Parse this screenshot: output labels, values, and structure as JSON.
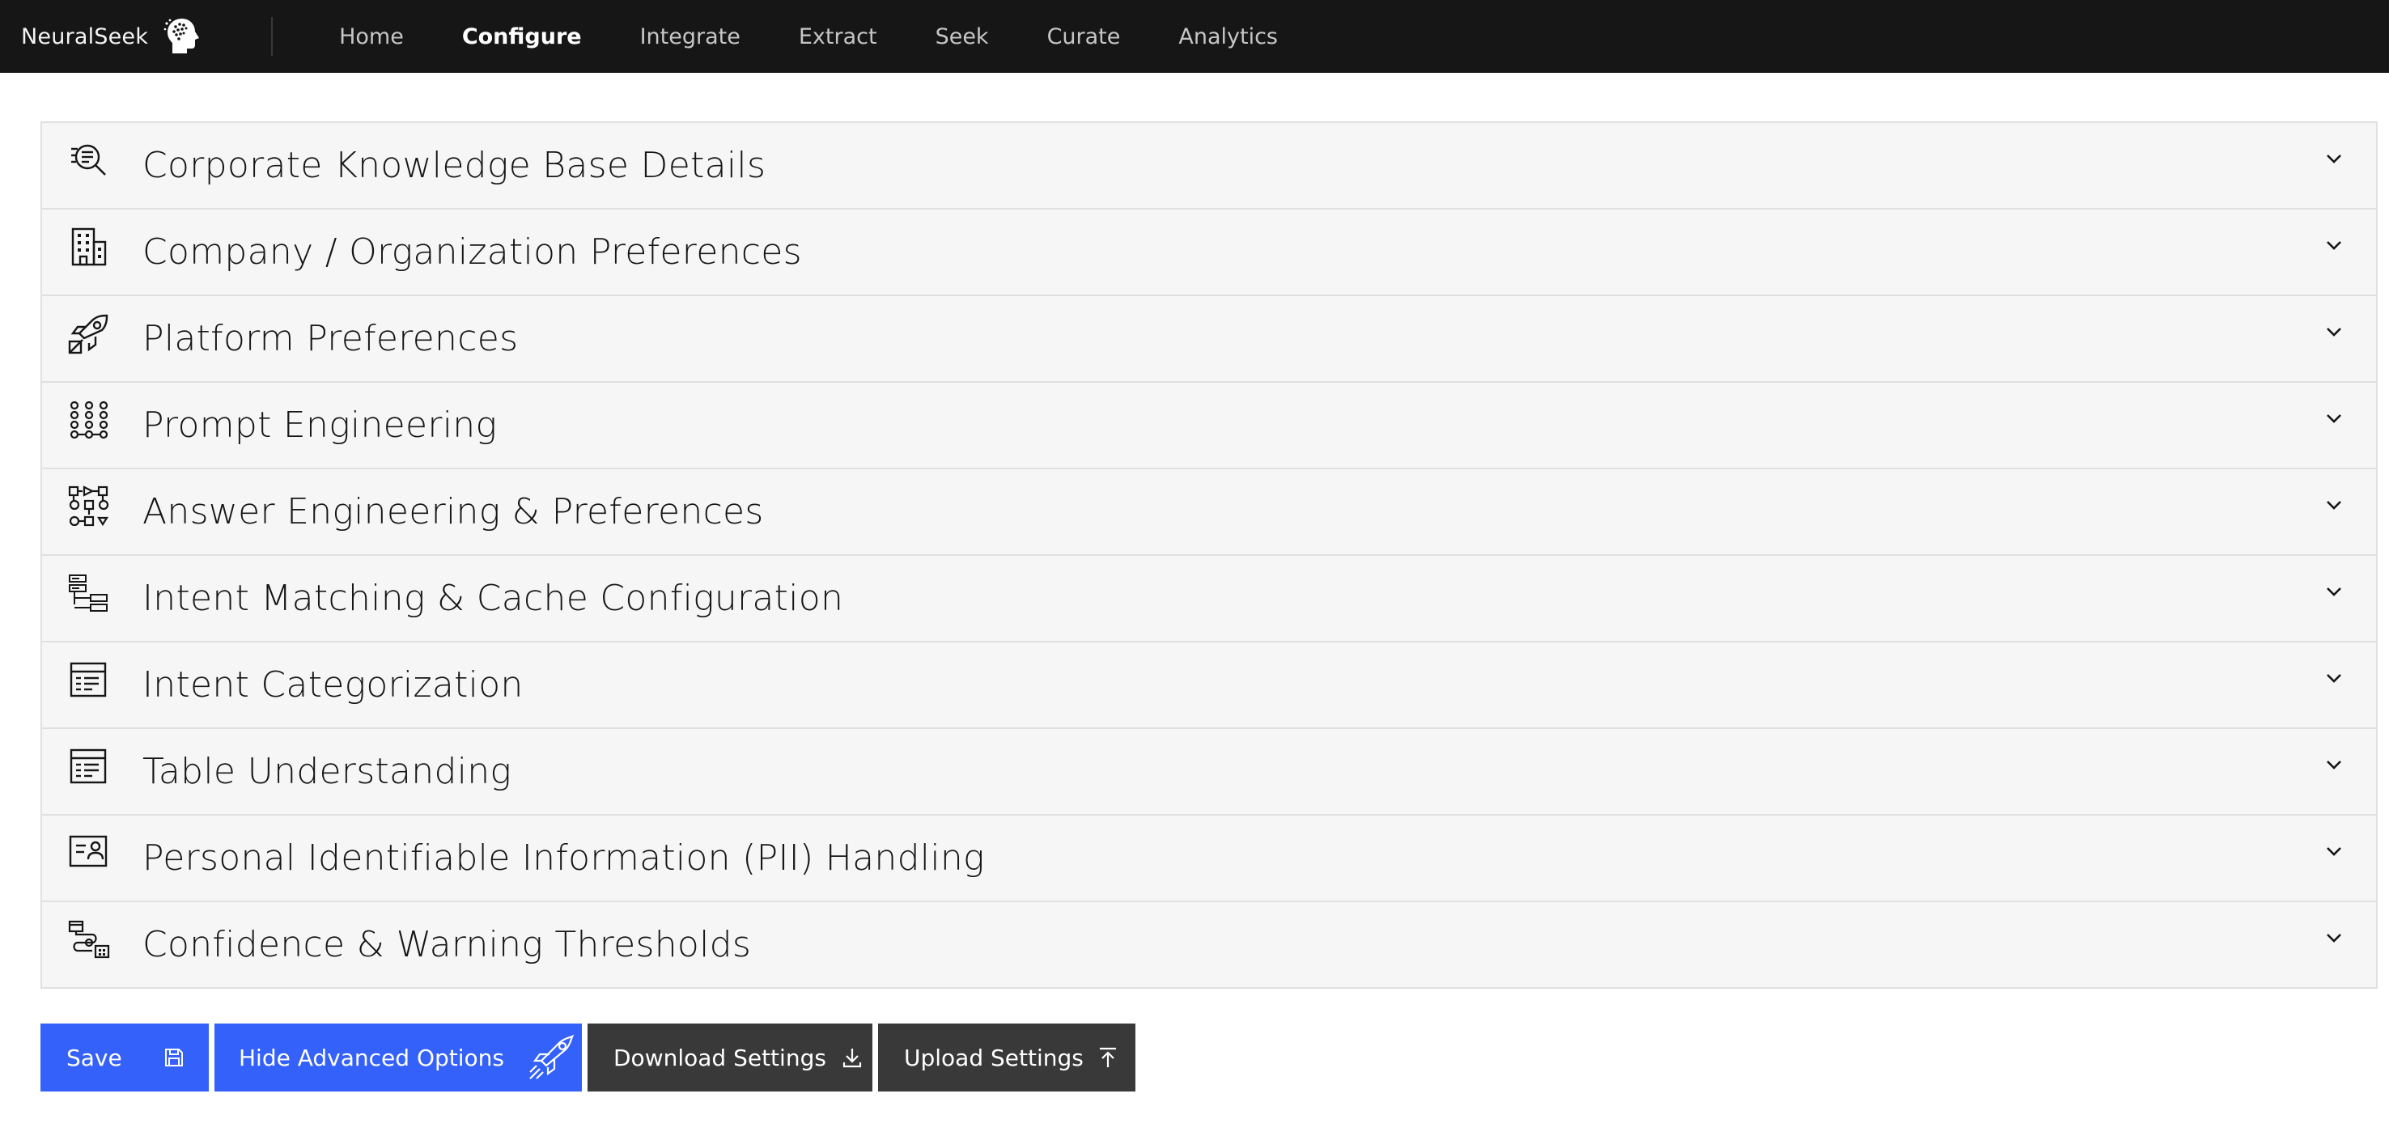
{
  "app": {
    "brand_name": "NeuralSeek",
    "brand_icon": "brain-head-icon"
  },
  "nav": {
    "items": [
      {
        "label": "Home",
        "active": false
      },
      {
        "label": "Configure",
        "active": true
      },
      {
        "label": "Integrate",
        "active": false
      },
      {
        "label": "Extract",
        "active": false
      },
      {
        "label": "Seek",
        "active": false
      },
      {
        "label": "Curate",
        "active": false
      },
      {
        "label": "Analytics",
        "active": false
      }
    ]
  },
  "sections": [
    {
      "title": "Corporate Knowledge Base Details",
      "icon": "document-search-icon"
    },
    {
      "title": "Company / Organization Preferences",
      "icon": "building-icon"
    },
    {
      "title": "Platform Preferences",
      "icon": "rocket-platform-icon"
    },
    {
      "title": "Prompt Engineering",
      "icon": "node-grid-icon"
    },
    {
      "title": "Answer Engineering & Preferences",
      "icon": "flow-shapes-icon"
    },
    {
      "title": "Intent Matching & Cache Configuration",
      "icon": "tree-view-icon"
    },
    {
      "title": "Intent Categorization",
      "icon": "table-list-icon"
    },
    {
      "title": "Table Understanding",
      "icon": "table-list-icon"
    },
    {
      "title": "Personal Identifiable Information (PII) Handling",
      "icon": "identity-card-icon"
    },
    {
      "title": "Confidence & Warning Thresholds",
      "icon": "workflow-automation-icon"
    }
  ],
  "actions": {
    "save_label": "Save",
    "hide_advanced_label": "Hide Advanced Options",
    "download_label": "Download Settings",
    "upload_label": "Upload Settings"
  },
  "colors": {
    "topbar": "#161616",
    "primary": "#3461f9",
    "secondary": "#393939",
    "accordion_bg": "#f6f6f6"
  }
}
